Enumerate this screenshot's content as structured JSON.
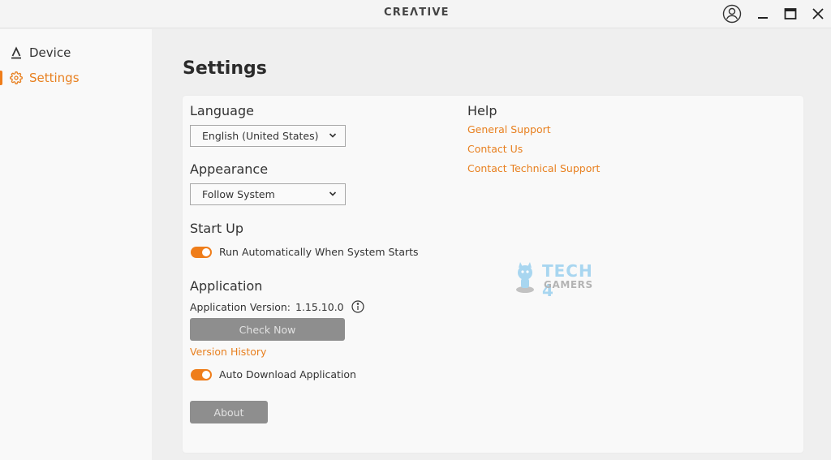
{
  "titlebar": {
    "logo": "CREΛTIVE",
    "icons": {
      "account": "user-circle-icon",
      "minimize": "minimize-icon",
      "maximize": "maximize-icon",
      "close": "close-icon"
    }
  },
  "sidebar": {
    "items": [
      {
        "label": "Device",
        "icon": "device-triangle-icon",
        "active": false
      },
      {
        "label": "Settings",
        "icon": "gear-icon",
        "active": true
      }
    ]
  },
  "page": {
    "title": "Settings"
  },
  "language": {
    "heading": "Language",
    "selected": "English (United States)"
  },
  "appearance": {
    "heading": "Appearance",
    "selected": "Follow System"
  },
  "startup": {
    "heading": "Start Up",
    "toggle_label": "Run Automatically When System Starts",
    "enabled": true
  },
  "application": {
    "heading": "Application",
    "version_label": "Application Version:",
    "version": "1.15.10.0",
    "check_button": "Check Now",
    "history_link": "Version History",
    "auto_download_label": "Auto Download Application",
    "auto_download_enabled": true,
    "about_button": "About"
  },
  "help": {
    "heading": "Help",
    "links": [
      "General Support",
      "Contact Us",
      "Contact Technical Support"
    ]
  },
  "watermark": {
    "line1": "TECH 4",
    "line2": "GAMERS"
  },
  "colors": {
    "accent": "#ef7d1a",
    "button_gray": "#8e8e8e"
  }
}
